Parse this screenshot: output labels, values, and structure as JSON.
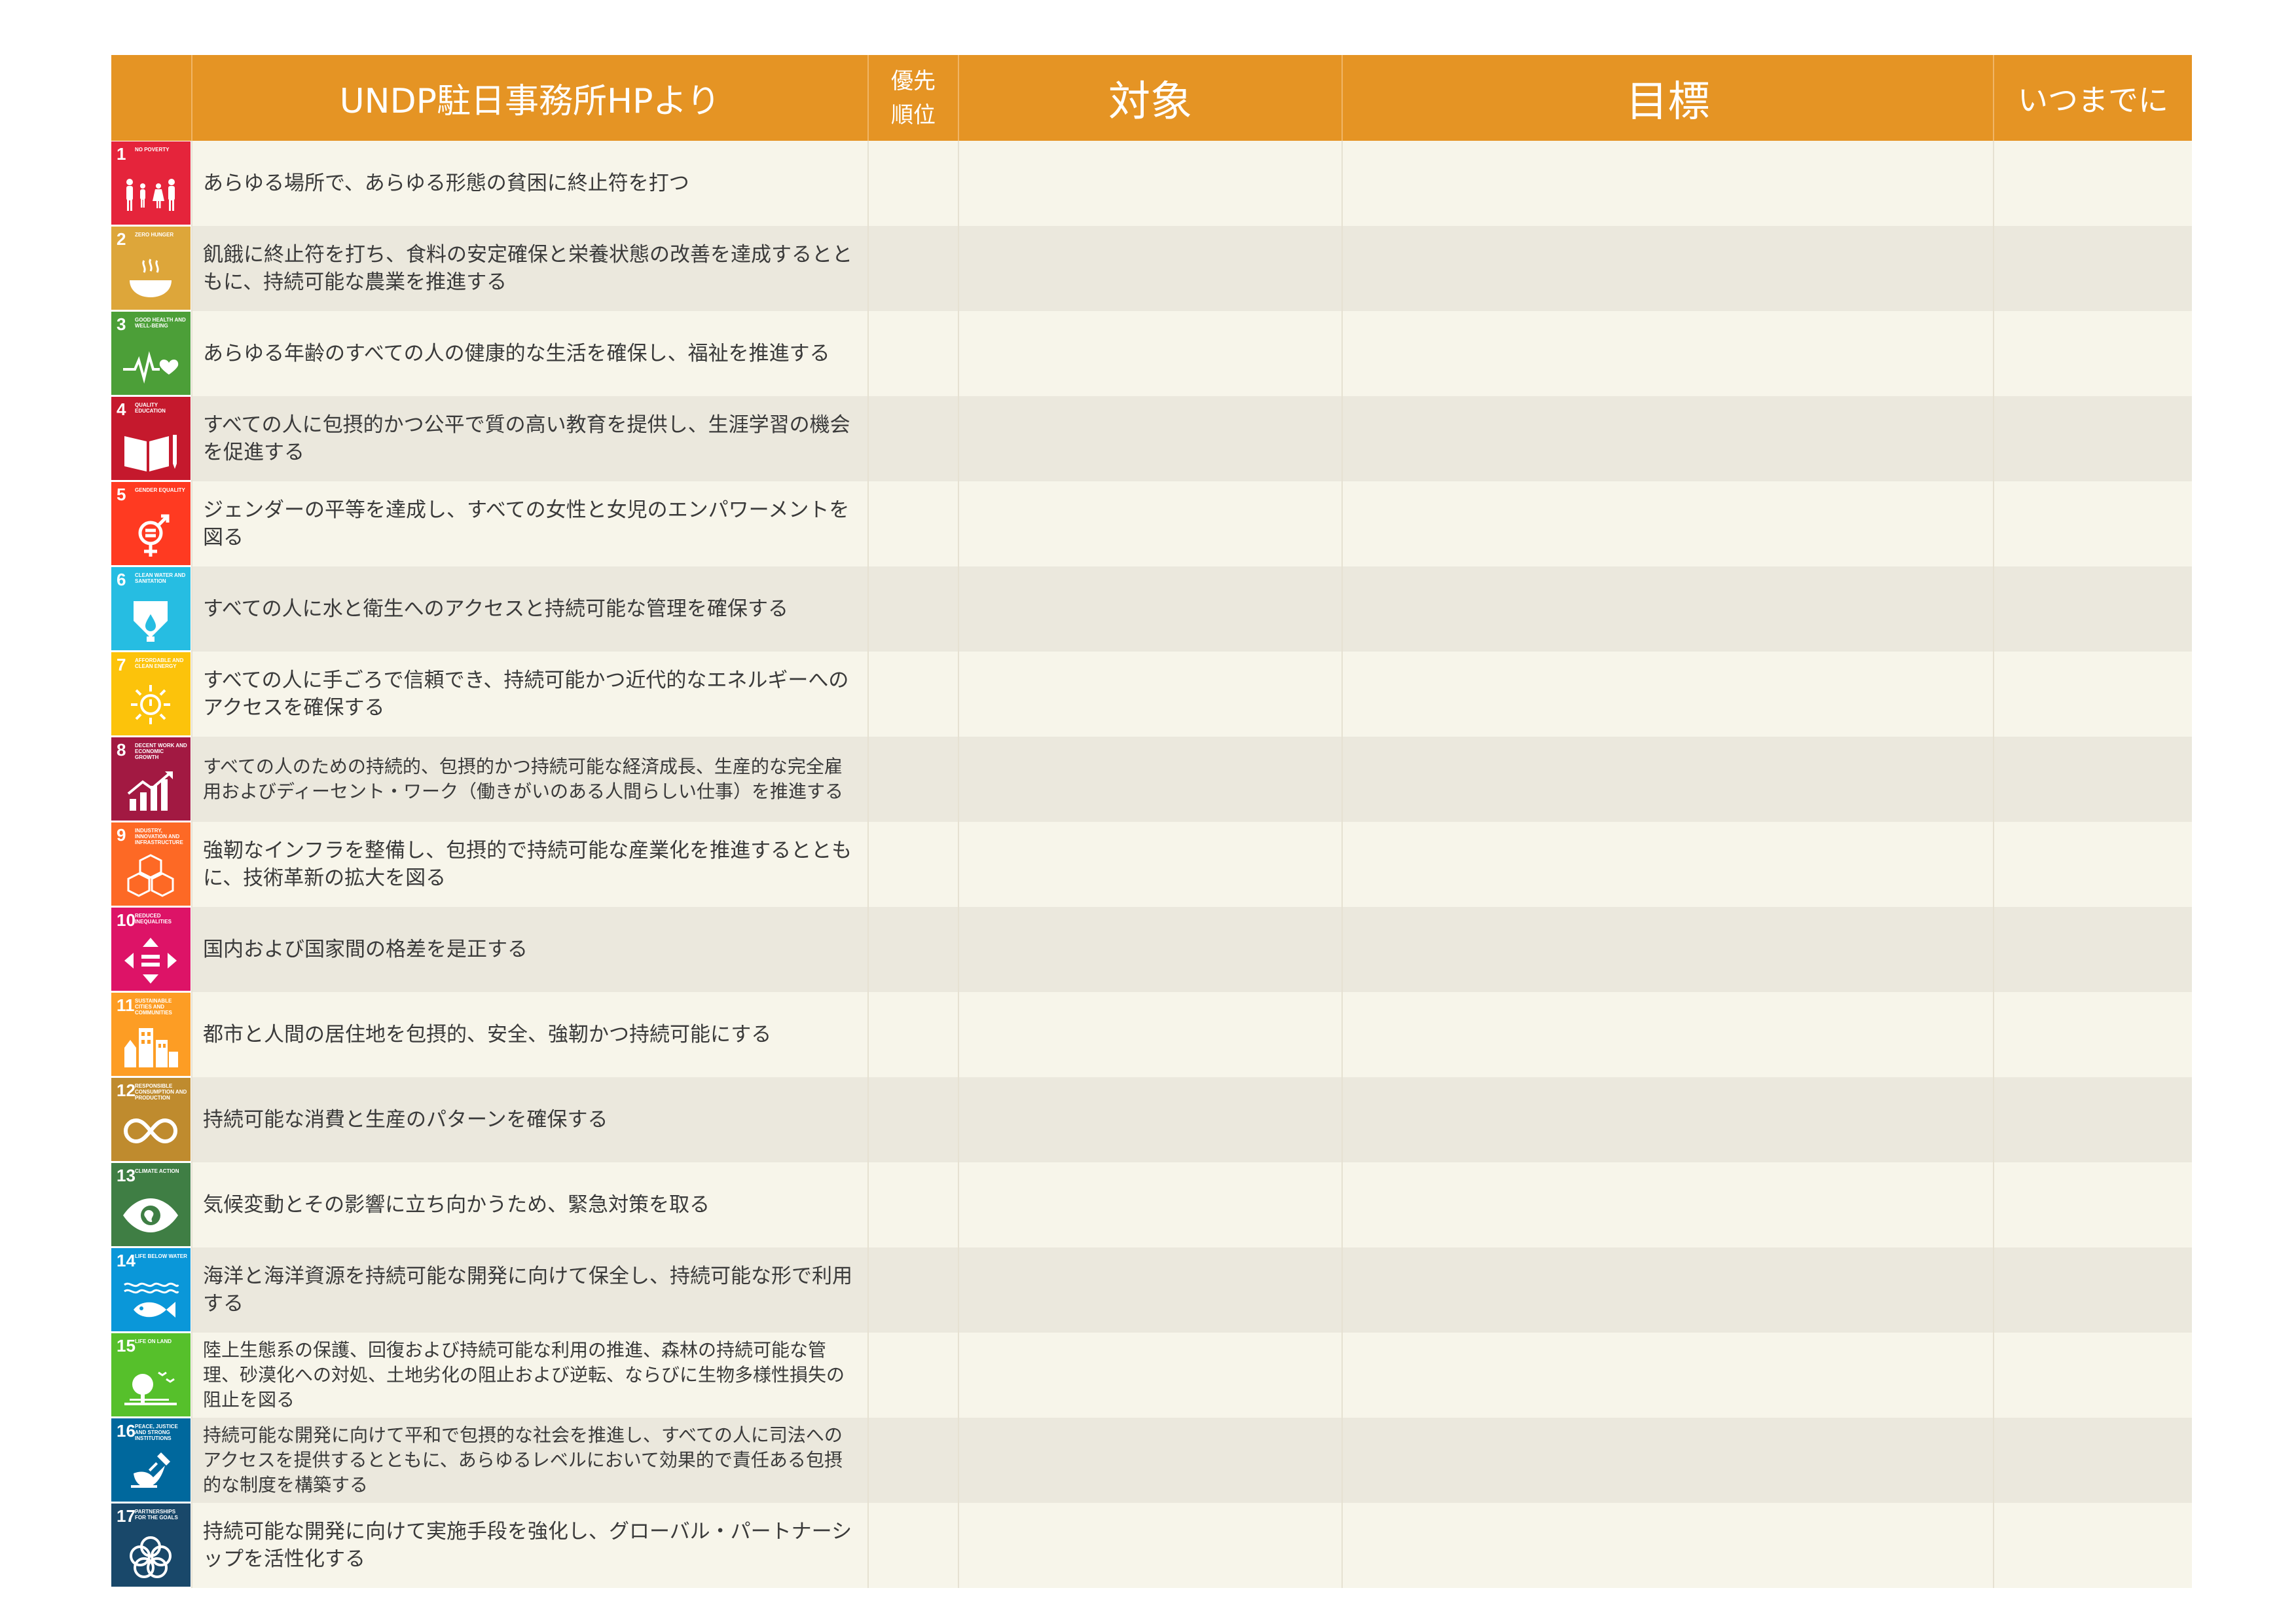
{
  "header": {
    "icon_col": "",
    "description": "UNDP駐日事務所HPより",
    "priority": "優先\n順位",
    "target": "対象",
    "goal": "目標",
    "deadline": "いつまでに"
  },
  "goals": [
    {
      "num": "1",
      "title": "NO POVERTY",
      "color": "#e5243b",
      "icon": "family-icon",
      "text": "あらゆる場所で、あらゆる形態の貧困に終止符を打つ"
    },
    {
      "num": "2",
      "title": "ZERO HUNGER",
      "color": "#dda63a",
      "icon": "bowl-icon",
      "text": "飢餓に終止符を打ち、食料の安定確保と栄養状態の改善を達成するとともに、持続可能な農業を推進する"
    },
    {
      "num": "3",
      "title": "GOOD HEALTH AND WELL-BEING",
      "color": "#4c9f38",
      "icon": "heartbeat-icon",
      "text": "あらゆる年齢のすべての人の健康的な生活を確保し、福祉を推進する"
    },
    {
      "num": "4",
      "title": "QUALITY EDUCATION",
      "color": "#c5192d",
      "icon": "book-pencil-icon",
      "text": "すべての人に包摂的かつ公平で質の高い教育を提供し、生涯学習の機会を促進する"
    },
    {
      "num": "5",
      "title": "GENDER EQUALITY",
      "color": "#ff3a21",
      "icon": "gender-equality-icon",
      "text": "ジェンダーの平等を達成し、すべての女性と女児のエンパワーメントを図る"
    },
    {
      "num": "6",
      "title": "CLEAN WATER AND SANITATION",
      "color": "#26bde2",
      "icon": "water-drop-icon",
      "text": "すべての人に水と衛生へのアクセスと持続可能な管理を確保する"
    },
    {
      "num": "7",
      "title": "AFFORDABLE AND CLEAN ENERGY",
      "color": "#fcc30b",
      "icon": "sun-power-icon",
      "text": "すべての人に手ごろで信頼でき、持続可能かつ近代的なエネルギーへのアクセスを確保する"
    },
    {
      "num": "8",
      "title": "DECENT WORK AND ECONOMIC GROWTH",
      "color": "#a21942",
      "icon": "growth-chart-icon",
      "text": "すべての人のための持続的、包摂的かつ持続可能な経済成長、生産的な完全雇用およびディーセント・ワーク（働きがいのある人間らしい仕事）を推進する",
      "small": true
    },
    {
      "num": "9",
      "title": "INDUSTRY, INNOVATION AND INFRASTRUCTURE",
      "color": "#fd6925",
      "icon": "cubes-icon",
      "text": "強靭なインフラを整備し、包摂的で持続可能な産業化を推進するとともに、技術革新の拡大を図る"
    },
    {
      "num": "10",
      "title": "REDUCED INEQUALITIES",
      "color": "#dd1367",
      "icon": "equality-arrows-icon",
      "text": "国内および国家間の格差を是正する"
    },
    {
      "num": "11",
      "title": "SUSTAINABLE CITIES AND COMMUNITIES",
      "color": "#fd9d24",
      "icon": "city-icon",
      "text": "都市と人間の居住地を包摂的、安全、強靭かつ持続可能にする"
    },
    {
      "num": "12",
      "title": "RESPONSIBLE CONSUMPTION AND PRODUCTION",
      "color": "#bf8b2e",
      "icon": "infinity-icon",
      "text": "持続可能な消費と生産のパターンを確保する"
    },
    {
      "num": "13",
      "title": "CLIMATE ACTION",
      "color": "#3f7e44",
      "icon": "eye-globe-icon",
      "text": "気候変動とその影響に立ち向かうため、緊急対策を取る"
    },
    {
      "num": "14",
      "title": "LIFE BELOW WATER",
      "color": "#0a97d9",
      "icon": "fish-icon",
      "text": "海洋と海洋資源を持続可能な開発に向けて保全し、持続可能な形で利用する"
    },
    {
      "num": "15",
      "title": "LIFE ON LAND",
      "color": "#56c02b",
      "icon": "tree-birds-icon",
      "text": "陸上生態系の保護、回復および持続可能な利用の推進、森林の持続可能な管理、砂漠化への対処、土地劣化の阻止および逆転、ならびに生物多様性損失の阻止を図る",
      "small": true
    },
    {
      "num": "16",
      "title": "PEACE, JUSTICE AND STRONG INSTITUTIONS",
      "color": "#00689d",
      "icon": "dove-gavel-icon",
      "text": "持続可能な開発に向けて平和で包摂的な社会を推進し、すべての人に司法へのアクセスを提供するとともに、あらゆるレベルにおいて効果的で責任ある包摂的な制度を構築する",
      "small": true
    },
    {
      "num": "17",
      "title": "PARTNERSHIPS FOR THE GOALS",
      "color": "#19486a",
      "icon": "flower-rings-icon",
      "text": "持続可能な開発に向けて実施手段を強化し、グローバル・パートナーシップを活性化する"
    }
  ]
}
